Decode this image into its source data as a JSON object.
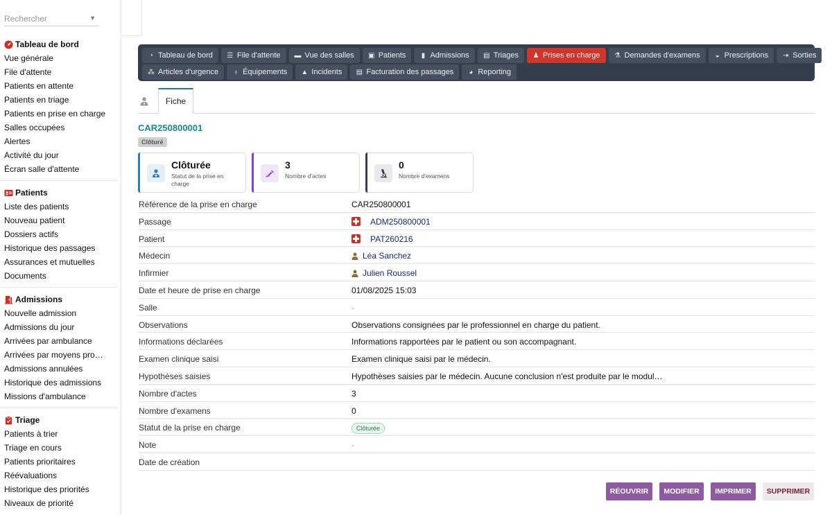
{
  "sidebar": {
    "search_placeholder": "Rechercher",
    "sections": [
      {
        "title": "Tableau de bord",
        "icon": "dashboard-icon",
        "items": [
          "Vue générale",
          "File d'attente",
          "Patients en attente",
          "Patients en triage",
          "Patients en prise en charge",
          "Salles occupées",
          "Alertes",
          "Activité du jour",
          "Écran salle d'attente"
        ]
      },
      {
        "title": "Patients",
        "icon": "id-card-icon",
        "items": [
          "Liste des patients",
          "Nouveau patient",
          "Dossiers actifs",
          "Historique des passages",
          "Assurances et mutuelles",
          "Documents"
        ]
      },
      {
        "title": "Admissions",
        "icon": "door-icon",
        "items": [
          "Nouvelle admission",
          "Admissions du jour",
          "Arrivées par ambulance",
          "Arrivées par moyens pro…",
          "Admissions annulées",
          "Historique des admissions",
          "Missions d'ambulance"
        ]
      },
      {
        "title": "Triage",
        "icon": "clipboard-icon",
        "items": [
          "Patients à trier",
          "Triage en cours",
          "Patients prioritaires",
          "Réévaluations",
          "Historique des priorités",
          "Niveaux de priorité"
        ]
      }
    ]
  },
  "nav": {
    "row1": [
      {
        "label": "Tableau de bord",
        "icon": "◔"
      },
      {
        "label": "File d'attente",
        "icon": "☰"
      },
      {
        "label": "Vue des salles",
        "icon": "▬"
      },
      {
        "label": "Patients",
        "icon": "▣"
      },
      {
        "label": "Admissions",
        "icon": "▮"
      },
      {
        "label": "Triages",
        "icon": "▤"
      },
      {
        "label": "Prises en charge",
        "icon": "♟"
      },
      {
        "label": "Demandes d'examens",
        "icon": "⚗"
      },
      {
        "label": "Prescriptions",
        "icon": "◒"
      },
      {
        "label": "Sorties",
        "icon": "⇥"
      }
    ],
    "row2": [
      {
        "label": "Articles d'urgence",
        "icon": "⁂"
      },
      {
        "label": "Équipements",
        "icon": "♁"
      },
      {
        "label": "Incidents",
        "icon": "▲"
      },
      {
        "label": "Facturation des passages",
        "icon": "▤"
      },
      {
        "label": "Reporting",
        "icon": "◕"
      }
    ],
    "active": "Prises en charge"
  },
  "tabs": {
    "fiche": "Fiche"
  },
  "record": {
    "reference": "CAR250800001",
    "status_chip": "Clôturé"
  },
  "cards": [
    {
      "value": "Clôturée",
      "label": "Statut de la prise en charge",
      "icon": "user-md-icon",
      "color": "#2a7fb8"
    },
    {
      "value": "3",
      "label": "Nombre d'actes",
      "icon": "syringe-icon",
      "color": "#8a3fd1"
    },
    {
      "value": "0",
      "label": "Nombre d'examens",
      "icon": "microscope-icon",
      "color": "#333d4c"
    }
  ],
  "fields": [
    {
      "label": "Référence de la prise en charge",
      "value": "CAR250800001"
    },
    {
      "label": "Passage",
      "value": "ADM250800001"
    },
    {
      "label": "Patient",
      "value": "PAT260216"
    },
    {
      "label": "Médecin",
      "value": "Léa Sanchez"
    },
    {
      "label": "Infirmier",
      "value": "Julien Roussel"
    },
    {
      "label": "Date et heure de prise en charge",
      "value": "01/08/2025 15:03"
    },
    {
      "label": "Salle",
      "value": "-"
    },
    {
      "label": "Observations",
      "value": "Observations consignées par le professionnel en charge du patient."
    },
    {
      "label": "Informations déclarées",
      "value": "Informations rapportées par le patient ou son accompagnant."
    },
    {
      "label": "Examen clinique saisi",
      "value": "Examen clinique saisi par le médecin."
    },
    {
      "label": "Hypothèses saisies",
      "value": "Hypothèses saisies par le médecin. Aucune conclusion n'est produite par le modul…"
    },
    {
      "label": "Nombre d'actes",
      "value": "3"
    },
    {
      "label": "Nombre d'examens",
      "value": "0"
    },
    {
      "label": "Statut de la prise en charge",
      "value": "Clôturée"
    },
    {
      "label": "Note",
      "value": "-"
    },
    {
      "label": "Date de création",
      "value": ""
    }
  ],
  "actions": {
    "reopen": "RÉOUVRIR",
    "edit": "MODIFIER",
    "print": "IMPRIMER",
    "delete": "SUPPRIMER"
  }
}
